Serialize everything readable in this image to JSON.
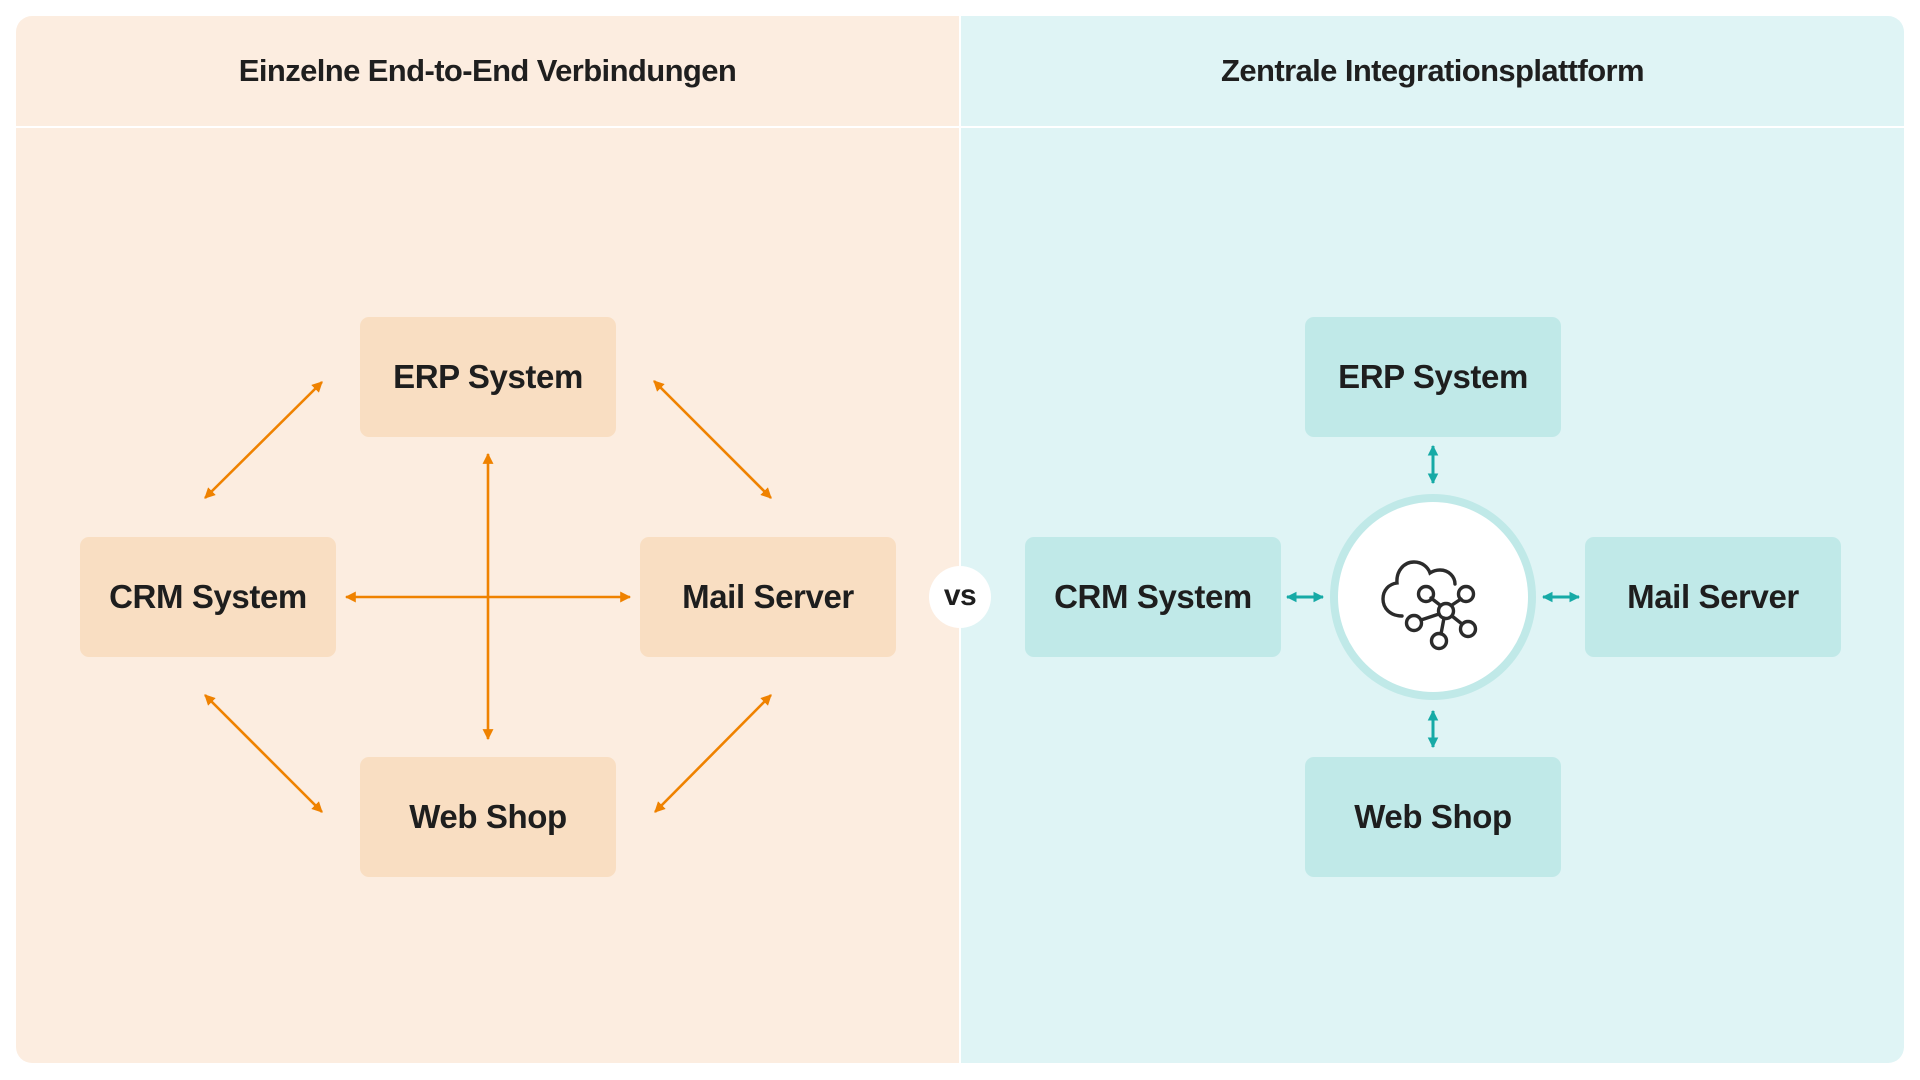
{
  "colors": {
    "left_panel_bg": "#fcede0",
    "right_panel_bg": "#dff4f5",
    "left_node_bg": "#f9dec2",
    "right_node_bg": "#c0e9e8",
    "left_arrow": "#ef8200",
    "right_arrow": "#16aaa6",
    "text": "#1e1e1e"
  },
  "left_panel": {
    "title": "Einzelne End-to-End Verbindungen",
    "nodes": {
      "erp": "ERP System",
      "crm": "CRM System",
      "mail": "Mail Server",
      "web": "Web Shop"
    },
    "connections": [
      [
        "crm",
        "erp"
      ],
      [
        "erp",
        "mail"
      ],
      [
        "crm",
        "web"
      ],
      [
        "web",
        "mail"
      ],
      [
        "crm",
        "mail"
      ],
      [
        "erp",
        "web"
      ]
    ]
  },
  "separator": {
    "label": "vs"
  },
  "right_panel": {
    "title": "Zentrale Integrationsplattform",
    "hub_icon": "cloud-network-icon",
    "nodes": {
      "erp": "ERP System",
      "crm": "CRM System",
      "mail": "Mail Server",
      "web": "Web Shop"
    },
    "connections": [
      [
        "hub",
        "erp"
      ],
      [
        "hub",
        "crm"
      ],
      [
        "hub",
        "mail"
      ],
      [
        "hub",
        "web"
      ]
    ]
  }
}
